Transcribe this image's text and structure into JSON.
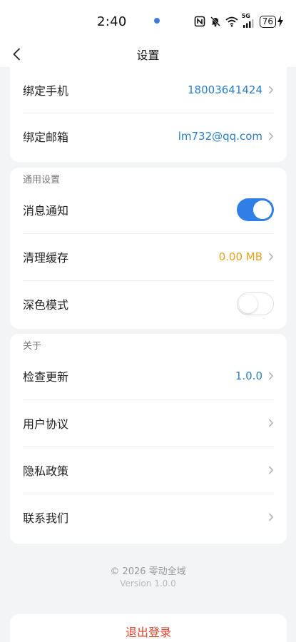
{
  "status_bar": {
    "time": "2:40",
    "battery_level": "76",
    "network": "5G",
    "icons": [
      "nfc-icon",
      "mute-icon",
      "wifi-icon",
      "signal-icon",
      "battery-icon",
      "charging-icon"
    ]
  },
  "nav": {
    "title": "设置",
    "back_icon": "chevron-left-icon"
  },
  "account": {
    "rows": [
      {
        "label": "绑定手机",
        "value": "18003641424"
      },
      {
        "label": "绑定邮箱",
        "value": "lm732@qq.com"
      }
    ]
  },
  "general": {
    "section_label": "通用设置",
    "notifications": {
      "label": "消息通知",
      "enabled": true
    },
    "cache": {
      "label": "清理缓存",
      "value": "0.00 MB"
    },
    "dark_mode": {
      "label": "深色模式",
      "enabled": false
    }
  },
  "about": {
    "section_label": "关于",
    "rows": [
      {
        "label": "检查更新",
        "value": "1.0.0"
      },
      {
        "label": "用户协议",
        "value": ""
      },
      {
        "label": "隐私政策",
        "value": ""
      },
      {
        "label": "联系我们",
        "value": ""
      }
    ]
  },
  "footer": {
    "copyright": "© 2026 零动全域",
    "version": "Version 1.0.0"
  },
  "logout": {
    "label": "退出登录"
  },
  "colors": {
    "accent": "#2f7fe6",
    "link_value": "#2b7fc6",
    "cache_value": "#e7a21c",
    "logout": "#e0432e",
    "background": "#f3f4f6"
  }
}
